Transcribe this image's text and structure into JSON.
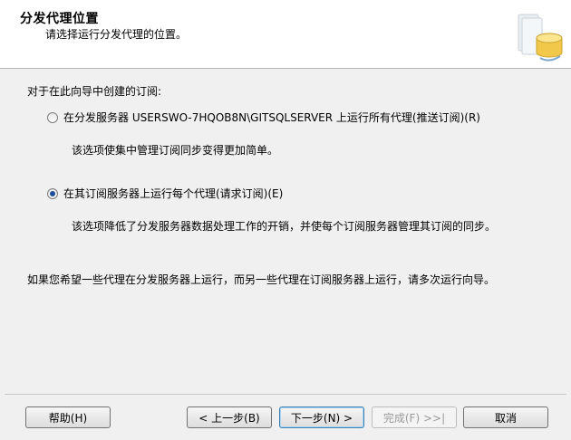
{
  "header": {
    "title": "分发代理位置",
    "subtitle": "请选择运行分发代理的位置。"
  },
  "body": {
    "intro": "对于在此向导中创建的订阅:",
    "options": [
      {
        "label": "在分发服务器 USERSWO-7HQOB8N\\GITSQLSERVER 上运行所有代理(推送订阅)(R)",
        "description": "该选项使集中管理订阅同步变得更加简单。",
        "selected": false
      },
      {
        "label": "在其订阅服务器上运行每个代理(请求订阅)(E)",
        "description": "该选项降低了分发服务器数据处理工作的开销，并使每个订阅服务器管理其订阅的同步。",
        "selected": true
      }
    ],
    "note": "如果您希望一些代理在分发服务器上运行，而另一些代理在订阅服务器上运行，请多次运行向导。"
  },
  "buttons": {
    "help": "帮助(H)",
    "back": "< 上一步(B)",
    "next": "下一步(N) >",
    "finish": "完成(F) >>|",
    "cancel": "取消"
  }
}
